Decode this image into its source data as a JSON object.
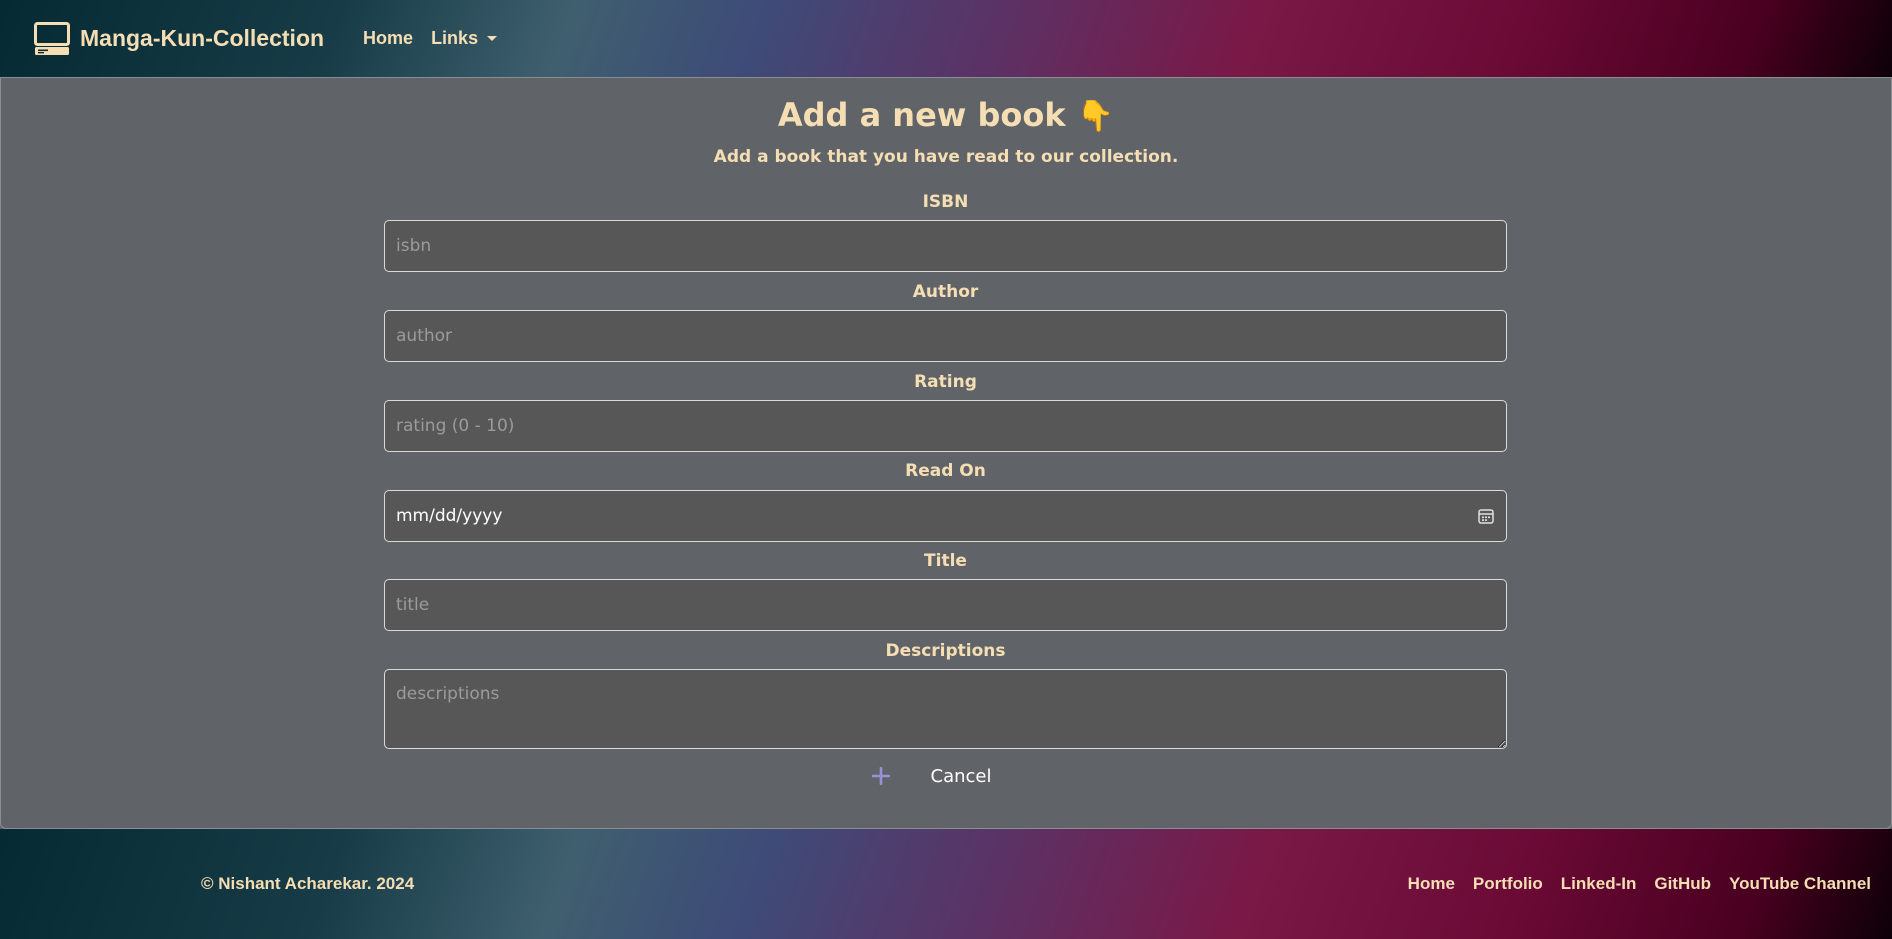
{
  "navbar": {
    "brand": "Manga-Kun-Collection",
    "brand_icon": "computer-icon",
    "links": [
      {
        "label": "Home"
      },
      {
        "label": "Links"
      }
    ]
  },
  "form": {
    "title": "Add a new book",
    "title_emoji": "👇",
    "subtitle": "Add a book that you have read to our collection.",
    "fields": {
      "isbn": {
        "label": "ISBN",
        "placeholder": "isbn"
      },
      "author": {
        "label": "Author",
        "placeholder": "author"
      },
      "rating": {
        "label": "Rating",
        "placeholder": "rating (0 - 10)"
      },
      "read_on": {
        "label": "Read On",
        "value": "mm/dd/yyyy"
      },
      "title": {
        "label": "Title",
        "placeholder": "title"
      },
      "descriptions": {
        "label": "Descriptions",
        "placeholder": "descriptions"
      }
    },
    "add_icon": "plus-icon",
    "cancel_label": "Cancel"
  },
  "footer": {
    "copyright": "© Nishant Acharekar. 2024",
    "links": [
      "Home",
      "Portfolio",
      "Linked-In",
      "GitHub",
      "YouTube Channel"
    ]
  },
  "colors": {
    "accent_text": "#f5deb3",
    "panel": "#606468",
    "input_bg": "#575757",
    "plus_icon": "#9b8fd6"
  }
}
